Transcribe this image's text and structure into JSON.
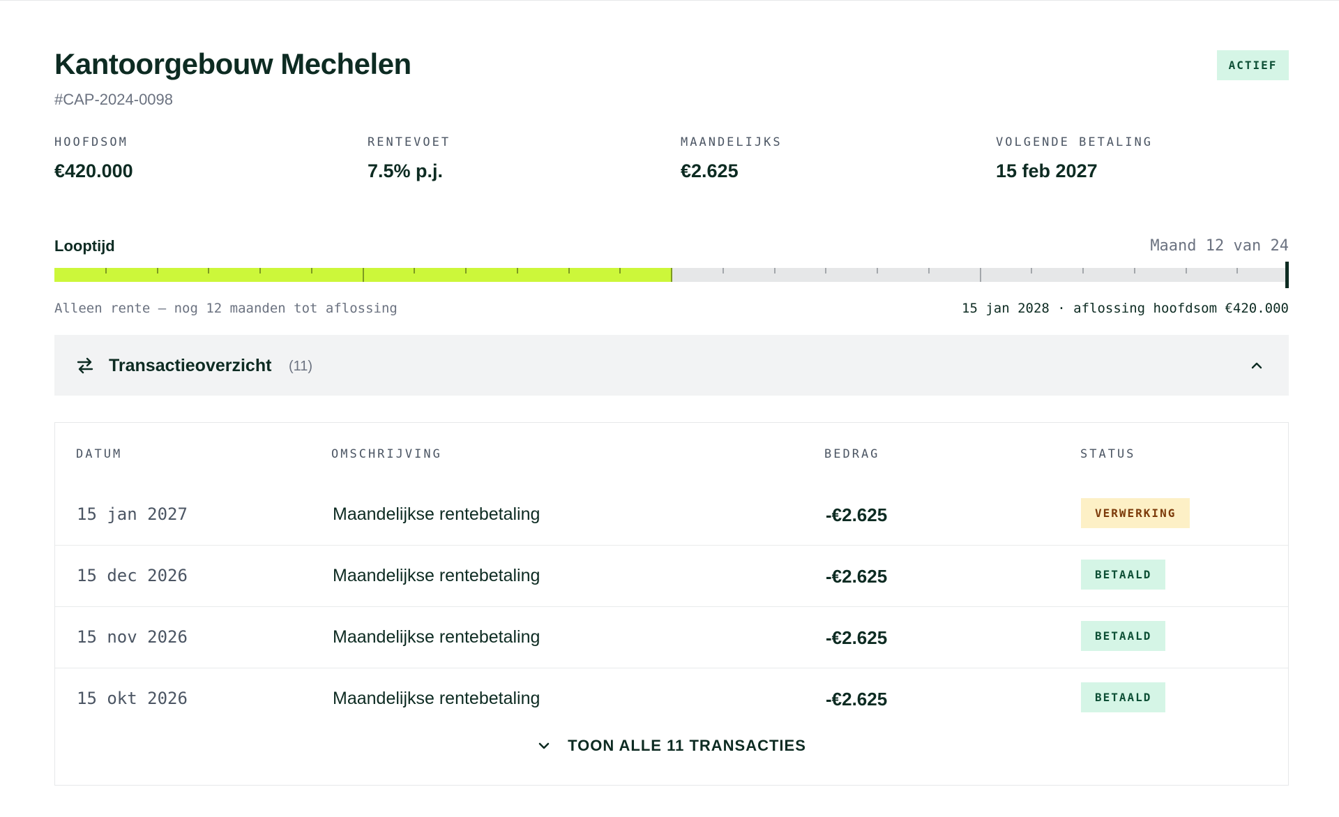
{
  "project": {
    "title": "Kantoorgebouw Mechelen",
    "code": "#CAP-2024-0098",
    "status": "ACTIEF"
  },
  "stats": [
    {
      "label": "HOOFDSOM",
      "value": "€420.000"
    },
    {
      "label": "RENTEVOET",
      "value": "7.5% p.j."
    },
    {
      "label": "MAANDELIJKS",
      "value": "€2.625"
    },
    {
      "label": "VOLGENDE BETALING",
      "value": "15 feb 2027"
    }
  ],
  "term": {
    "title": "Looptijd",
    "month_label": "Maand 12 van 24",
    "current_month": 12,
    "total_months": 24,
    "note_left": "Alleen rente — nog 12 maanden tot aflossing",
    "note_right": "15 jan 2028 · aflossing hoofdsom €420.000"
  },
  "transactions": {
    "title": "Transactieoverzicht",
    "count": "(11)",
    "columns": [
      "DATUM",
      "OMSCHRIJVING",
      "BEDRAG",
      "STATUS"
    ],
    "rows": [
      {
        "date": "15 jan 2027",
        "description": "Maandelijkse rentebetaling",
        "amount": "-€2.625",
        "status": "VERWERKING"
      },
      {
        "date": "15 dec 2026",
        "description": "Maandelijkse rentebetaling",
        "amount": "-€2.625",
        "status": "BETAALD"
      },
      {
        "date": "15 nov 2026",
        "description": "Maandelijkse rentebetaling",
        "amount": "-€2.625",
        "status": "BETAALD"
      },
      {
        "date": "15 okt 2026",
        "description": "Maandelijkse rentebetaling",
        "amount": "-€2.625",
        "status": "BETAALD"
      }
    ],
    "show_all_label": "TOON ALLE 11 TRANSACTIES"
  },
  "colors": {
    "accent": "#ccf73a",
    "ink": "#0d2b22",
    "paid_bg": "#d5f5e6",
    "processing_bg": "#fdf0c6"
  },
  "icons": {
    "transactions": "swap-arrows-icon",
    "collapse": "chevron-up-icon",
    "expand": "chevron-down-icon"
  }
}
